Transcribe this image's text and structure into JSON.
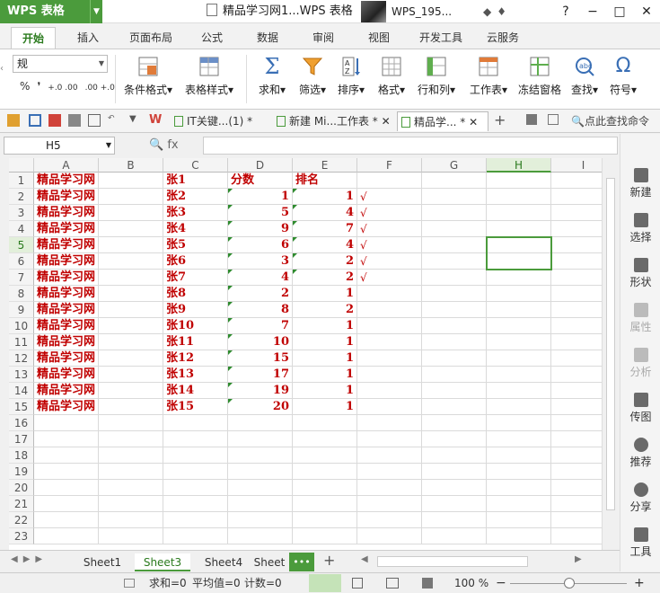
{
  "app": {
    "name": "WPS 表格",
    "doc_title": "精品学习网1...WPS 表格",
    "user": "WPS_195..."
  },
  "window_controls": [
    "?",
    "−",
    "□",
    "✕"
  ],
  "ribbon_tabs": [
    "开始",
    "插入",
    "页面布局",
    "公式",
    "数据",
    "审阅",
    "视图",
    "开发工具",
    "云服务"
  ],
  "active_tab": "开始",
  "ribbon": {
    "number_format": "规",
    "number_buttons": [
      "%",
      "❜",
      "+.0 .00",
      ".00 +.0"
    ],
    "buttons": [
      "条件格式▾",
      "表格样式▾",
      "求和▾",
      "筛选▾",
      "排序▾",
      "格式▾",
      "行和列▾",
      "工作表▾",
      "冻结窗格",
      "查找▾",
      "符号▾"
    ]
  },
  "doc_tabs": [
    {
      "label": "IT关键...(1) *",
      "close": "✕"
    },
    {
      "label": "新建 Mi...工作表 *",
      "close": "✕"
    },
    {
      "label": "精品学... *",
      "close": "✕"
    }
  ],
  "search_cmd": "点此查找命令",
  "name_box": "H5",
  "formula_icons": "🔍 fx",
  "formula": "",
  "columns": [
    "A",
    "B",
    "C",
    "D",
    "E",
    "F",
    "G",
    "H",
    "I"
  ],
  "row_numbers": [
    "1",
    "2",
    "3",
    "4",
    "5",
    "6",
    "7",
    "8",
    "9",
    "10",
    "11",
    "12",
    "13",
    "14",
    "15",
    "16",
    "17",
    "18",
    "19",
    "20",
    "21",
    "22",
    "23"
  ],
  "rows": [
    {
      "a": "精品学习网",
      "c": "张1",
      "d": "分数",
      "e": "排名",
      "f": ""
    },
    {
      "a": "精品学习网",
      "c": "张2",
      "d": "1",
      "e": "1",
      "f": "√"
    },
    {
      "a": "精品学习网",
      "c": "张3",
      "d": "5",
      "e": "4",
      "f": "√"
    },
    {
      "a": "精品学习网",
      "c": "张4",
      "d": "9",
      "e": "7",
      "f": "√"
    },
    {
      "a": "精品学习网",
      "c": "张5",
      "d": "6",
      "e": "4",
      "f": "√"
    },
    {
      "a": "精品学习网",
      "c": "张6",
      "d": "3",
      "e": "2",
      "f": "√"
    },
    {
      "a": "精品学习网",
      "c": "张7",
      "d": "4",
      "e": "2",
      "f": "√"
    },
    {
      "a": "精品学习网",
      "c": "张8",
      "d": "2",
      "e": "1",
      "f": ""
    },
    {
      "a": "精品学习网",
      "c": "张9",
      "d": "8",
      "e": "2",
      "f": ""
    },
    {
      "a": "精品学习网",
      "c": "张10",
      "d": "7",
      "e": "1",
      "f": ""
    },
    {
      "a": "精品学习网",
      "c": "张11",
      "d": "10",
      "e": "1",
      "f": ""
    },
    {
      "a": "精品学习网",
      "c": "张12",
      "d": "15",
      "e": "1",
      "f": ""
    },
    {
      "a": "精品学习网",
      "c": "张13",
      "d": "17",
      "e": "1",
      "f": ""
    },
    {
      "a": "精品学习网",
      "c": "张14",
      "d": "19",
      "e": "1",
      "f": ""
    },
    {
      "a": "精品学习网",
      "c": "张15",
      "d": "20",
      "e": "1",
      "f": ""
    }
  ],
  "side_panel": [
    "新建",
    "选择",
    "形状",
    "属性",
    "分析",
    "传图",
    "推荐",
    "分享",
    "工具"
  ],
  "sheets": [
    "Sheet1",
    "Sheet3",
    "Sheet4",
    "Sheet"
  ],
  "active_sheet": "Sheet3",
  "sheet_more": "•••",
  "status": {
    "sum": "求和=0",
    "avg": "平均值=0",
    "count": "计数=0",
    "zoom": "100 %"
  },
  "colors": {
    "accent": "#4b9b3c",
    "cell_text": "#c00000",
    "comment_marker": "#2e8b2e"
  }
}
